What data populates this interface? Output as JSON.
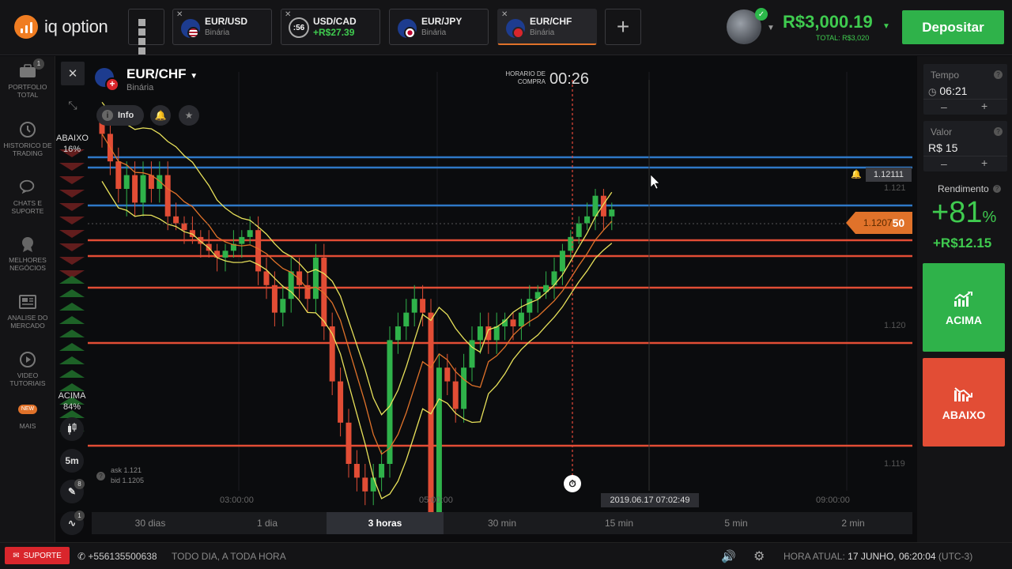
{
  "brand": {
    "name": "iq option"
  },
  "tabs": [
    {
      "name": "EUR/USD",
      "sub": "Binária",
      "active": false,
      "timer": null
    },
    {
      "name": "USD/CAD",
      "sub": "+R$27.39",
      "active": false,
      "timer": ":56"
    },
    {
      "name": "EUR/JPY",
      "sub": "Binária",
      "active": false,
      "timer": null
    },
    {
      "name": "EUR/CHF",
      "sub": "Binária",
      "active": true,
      "timer": null
    }
  ],
  "account": {
    "balance": "R$3,000.19",
    "total": "TOTAL: R$3,020",
    "deposit_label": "Depositar"
  },
  "sidebar": [
    {
      "label": "PORTFOLIO TOTAL",
      "icon": "briefcase-icon",
      "badge": "1"
    },
    {
      "label": "HISTORICO DE TRADING",
      "icon": "history-icon",
      "badge": null
    },
    {
      "label": "CHATS E SUPORTE",
      "icon": "chat-icon",
      "badge": null
    },
    {
      "label": "MELHORES NEGÓCIOS",
      "icon": "trophy-icon",
      "badge": null
    },
    {
      "label": "ANALISE DO MERCADO",
      "icon": "news-icon",
      "badge": null
    },
    {
      "label": "VIDEO TUTORIAIS",
      "icon": "play-icon",
      "badge": null
    },
    {
      "label": "MAIS",
      "icon": "more-icon",
      "badge": "NEW"
    }
  ],
  "chart_header": {
    "asset": "EUR/CHF",
    "asset_type": "Binária",
    "info_label": "Info",
    "purchase_label": "HORARIO DE COMPRA",
    "purchase_time": "00:26"
  },
  "sentiment": {
    "down_label": "ABAIXO",
    "down_pct": "16%",
    "up_label": "ACIMA",
    "up_pct": "84%"
  },
  "tools": {
    "period": "5m",
    "drawing_badge": "8",
    "indicator_badge": "1"
  },
  "quote": {
    "ask": "ask 1.121",
    "bid": "bid 1.1205"
  },
  "prices": {
    "current": "1.12111",
    "live_main": "1.1207",
    "live_tail": "50",
    "axis": [
      "1.121",
      "1.120",
      "1.119"
    ]
  },
  "time_axis": [
    "03:00:00",
    "05:00:00",
    "09:00:00"
  ],
  "cursor_time": "2019.06.17 07:02:49",
  "timeframes": [
    {
      "label": "30 dias",
      "active": false
    },
    {
      "label": "1 dia",
      "active": false
    },
    {
      "label": "3 horas",
      "active": true
    },
    {
      "label": "30 min",
      "active": false
    },
    {
      "label": "15 min",
      "active": false
    },
    {
      "label": "5 min",
      "active": false
    },
    {
      "label": "2 min",
      "active": false
    }
  ],
  "panel": {
    "time_label": "Tempo",
    "time_value": "06:21",
    "amount_label": "Valor",
    "amount_value": "R$ 15",
    "return_label": "Rendimento",
    "return_pct": "+81",
    "return_pct_unit": "%",
    "return_amount": "+R$12.15",
    "up_button": "ACIMA",
    "down_button": "ABAIXO"
  },
  "status": {
    "support_label": "SUPORTE",
    "phone": "+556135500638",
    "hours": "TODO DIA, A TODA HORA",
    "clock_label": "HORA ATUAL:",
    "clock_value": "17 JUNHO, 06:20:04",
    "timezone": "(UTC-3)"
  },
  "colors": {
    "green": "#2fb24a",
    "red": "#e24d35",
    "orange": "#e0722a",
    "blue": "#2e78c7",
    "yellow": "#e8e15a"
  },
  "candles": [
    [
      1.12155,
      1.1214,
      1.1216,
      1.1213
    ],
    [
      1.1214,
      1.1212,
      1.1215,
      1.1211
    ],
    [
      1.1212,
      1.121,
      1.1213,
      1.1209
    ],
    [
      1.121,
      1.1211,
      1.1212,
      1.1208
    ],
    [
      1.1211,
      1.1209,
      1.1212,
      1.1208
    ],
    [
      1.1209,
      1.1211,
      1.1212,
      1.1208
    ],
    [
      1.1211,
      1.121,
      1.1212,
      1.1209
    ],
    [
      1.121,
      1.1211,
      1.1212,
      1.1209
    ],
    [
      1.1211,
      1.1208,
      1.1212,
      1.1207
    ],
    [
      1.1208,
      1.12075,
      1.1209,
      1.1207
    ],
    [
      1.12075,
      1.1207,
      1.1208,
      1.1206
    ],
    [
      1.1207,
      1.12065,
      1.1208,
      1.1206
    ],
    [
      1.12065,
      1.1206,
      1.1207,
      1.1205
    ],
    [
      1.1206,
      1.12055,
      1.1207,
      1.1205
    ],
    [
      1.12055,
      1.1205,
      1.1206,
      1.1204
    ],
    [
      1.1205,
      1.12055,
      1.1206,
      1.1204
    ],
    [
      1.12055,
      1.1206,
      1.1207,
      1.1205
    ],
    [
      1.1206,
      1.12065,
      1.1207,
      1.1205
    ],
    [
      1.12065,
      1.1207,
      1.1208,
      1.1206
    ],
    [
      1.1207,
      1.1204,
      1.1208,
      1.1203
    ],
    [
      1.1204,
      1.1203,
      1.1205,
      1.1202
    ],
    [
      1.1203,
      1.1201,
      1.1204,
      1.12
    ],
    [
      1.1201,
      1.1202,
      1.1203,
      1.12
    ],
    [
      1.1202,
      1.1204,
      1.1205,
      1.1201
    ],
    [
      1.1204,
      1.1203,
      1.1205,
      1.1202
    ],
    [
      1.1203,
      1.1202,
      1.1204,
      1.1201
    ],
    [
      1.1202,
      1.1205,
      1.1206,
      1.1201
    ],
    [
      1.1205,
      1.12,
      1.1206,
      1.1199
    ],
    [
      1.12,
      1.1196,
      1.1201,
      1.1195
    ],
    [
      1.1196,
      1.1193,
      1.1197,
      1.1192
    ],
    [
      1.1193,
      1.119,
      1.1194,
      1.1189
    ],
    [
      1.119,
      1.1189,
      1.1191,
      1.1188
    ],
    [
      1.1189,
      1.1188,
      1.119,
      1.1187
    ],
    [
      1.1188,
      1.1189,
      1.119,
      1.1187
    ],
    [
      1.1189,
      1.119,
      1.1191,
      1.1188
    ],
    [
      1.119,
      1.1199,
      1.12,
      1.1189
    ],
    [
      1.1199,
      1.12,
      1.1201,
      1.1198
    ],
    [
      1.12,
      1.1201,
      1.1202,
      1.1199
    ],
    [
      1.1201,
      1.1202,
      1.1203,
      1.12
    ],
    [
      1.1202,
      1.1201,
      1.1203,
      1.12
    ],
    [
      1.1201,
      1.1186,
      1.1202,
      1.1185
    ],
    [
      1.1186,
      1.1197,
      1.1198,
      1.1185
    ],
    [
      1.1197,
      1.1196,
      1.1198,
      1.1195
    ],
    [
      1.1196,
      1.1194,
      1.1197,
      1.1193
    ],
    [
      1.1194,
      1.1197,
      1.1198,
      1.1193
    ],
    [
      1.1197,
      1.1199,
      1.12,
      1.1196
    ],
    [
      1.1199,
      1.12,
      1.1201,
      1.1198
    ],
    [
      1.12,
      1.1199,
      1.1201,
      1.1198
    ],
    [
      1.1199,
      1.12,
      1.1201,
      1.1198
    ],
    [
      1.12,
      1.12005,
      1.1201,
      1.1199
    ],
    [
      1.12005,
      1.12,
      1.1201,
      1.1199
    ],
    [
      1.12,
      1.1201,
      1.1202,
      1.1199
    ],
    [
      1.1201,
      1.1202,
      1.1203,
      1.12
    ],
    [
      1.1202,
      1.12025,
      1.1203,
      1.1201
    ],
    [
      1.12025,
      1.1203,
      1.1204,
      1.1202
    ],
    [
      1.1203,
      1.1204,
      1.1205,
      1.1202
    ],
    [
      1.1204,
      1.12055,
      1.1206,
      1.1203
    ],
    [
      1.12055,
      1.12065,
      1.1207,
      1.1205
    ],
    [
      1.12065,
      1.12075,
      1.1208,
      1.1206
    ],
    [
      1.12075,
      1.1208,
      1.1209,
      1.1207
    ],
    [
      1.1208,
      1.12095,
      1.121,
      1.1207
    ],
    [
      1.12095,
      1.1208,
      1.121,
      1.1207
    ],
    [
      1.1208,
      1.12085,
      1.1209,
      1.1207
    ]
  ]
}
